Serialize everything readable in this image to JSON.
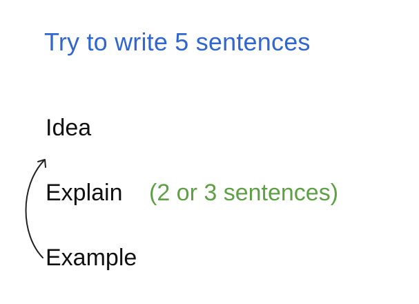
{
  "title": "Try to write 5 sentences",
  "steps": {
    "idea": "Idea",
    "explain": "Explain",
    "explain_note": "(2 or 3 sentences)",
    "example": "Example"
  },
  "arrow": {
    "from": "Example",
    "to": "Idea",
    "icon": "curved-arrow-icon"
  },
  "colors": {
    "title": "#2f66d0",
    "note": "#5fa046",
    "text": "#111111",
    "background": "#ffffff"
  }
}
